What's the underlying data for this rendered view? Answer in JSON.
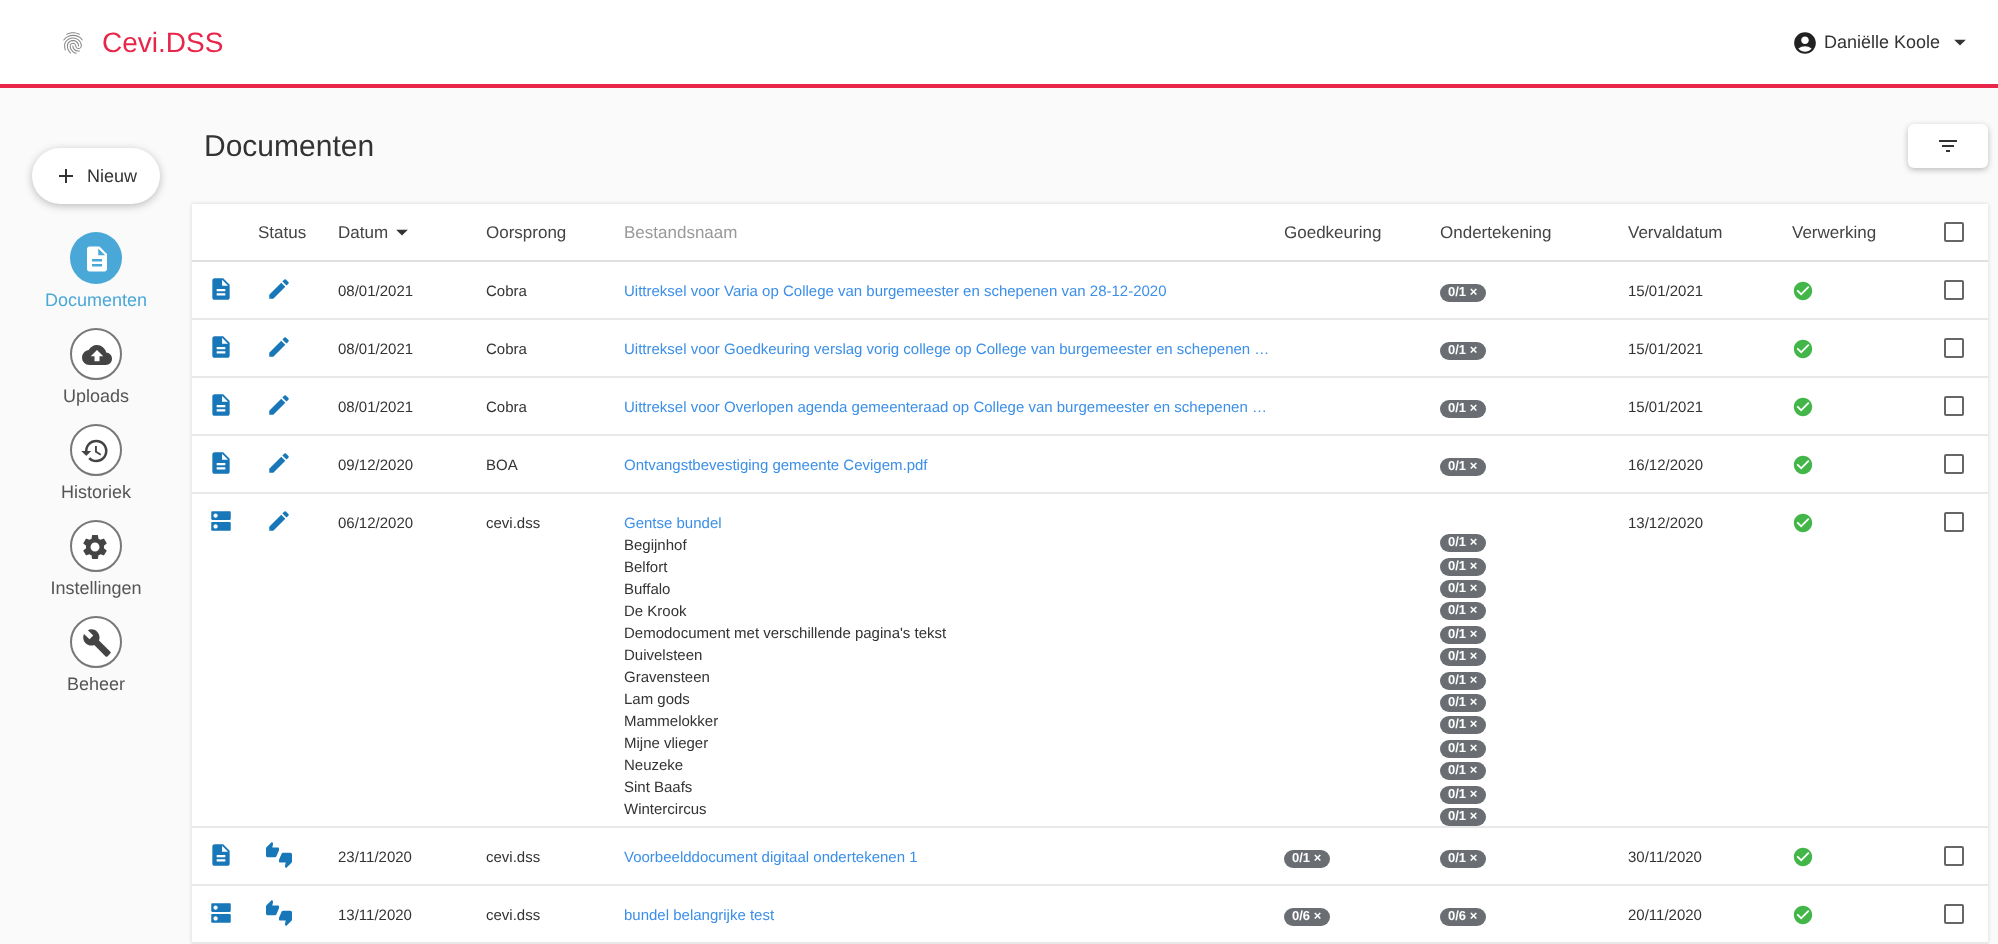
{
  "app": {
    "title": "Cevi.DSS"
  },
  "user": {
    "name": "Daniëlle Koole"
  },
  "new_button": {
    "label": "Nieuw"
  },
  "sidebar": {
    "items": [
      {
        "label": "Documenten",
        "kind": "documents",
        "selected": true
      },
      {
        "label": "Uploads",
        "kind": "uploads",
        "selected": false
      },
      {
        "label": "Historiek",
        "kind": "history",
        "selected": false
      },
      {
        "label": "Instellingen",
        "kind": "settings",
        "selected": false
      },
      {
        "label": "Beheer",
        "kind": "admin",
        "selected": false
      }
    ]
  },
  "page": {
    "title": "Documenten"
  },
  "table": {
    "columns": [
      "Status",
      "Datum",
      "Oorsprong",
      "Bestandsnaam",
      "Goedkeuring",
      "Ondertekening",
      "Vervaldatum",
      "Verwerking"
    ],
    "select_all": {
      "checked": false
    },
    "rows": [
      {
        "kind": "document",
        "status": {
          "kind": "edit"
        },
        "date": "08/01/2021",
        "origin": "Cobra",
        "name": "Uittreksel voor Varia op College van burgemeester en schepenen van 28-12-2020",
        "signing": "0/1 ×",
        "due": "15/01/2021",
        "processed": true,
        "checked": false
      },
      {
        "kind": "document",
        "status": {
          "kind": "edit"
        },
        "date": "08/01/2021",
        "origin": "Cobra",
        "name": "Uittreksel voor Goedkeuring verslag vorig college op College van burgemeester en schepenen …",
        "signing": "0/1 ×",
        "due": "15/01/2021",
        "processed": true,
        "checked": false
      },
      {
        "kind": "document",
        "status": {
          "kind": "edit"
        },
        "date": "08/01/2021",
        "origin": "Cobra",
        "name": "Uittreksel voor Overlopen agenda gemeenteraad op College van burgemeester en schepenen …",
        "signing": "0/1 ×",
        "due": "15/01/2021",
        "processed": true,
        "checked": false
      },
      {
        "kind": "document",
        "status": {
          "kind": "edit"
        },
        "date": "09/12/2020",
        "origin": "BOA",
        "name": "Ontvangstbevestiging gemeente Cevigem.pdf",
        "signing": "0/1 ×",
        "due": "16/12/2020",
        "processed": true,
        "checked": false
      },
      {
        "kind": "bundle",
        "status": {
          "kind": "edit"
        },
        "date": "06/12/2020",
        "origin": "cevi.dss",
        "name": "Gentse bundel",
        "due": "13/12/2020",
        "processed": true,
        "checked": false,
        "children": [
          {
            "name": "Begijnhof",
            "signing": "0/1 ×"
          },
          {
            "name": "Belfort",
            "signing": "0/1 ×"
          },
          {
            "name": "Buffalo",
            "signing": "0/1 ×"
          },
          {
            "name": "De Krook",
            "signing": "0/1 ×"
          },
          {
            "name": "Demodocument met verschillende pagina's tekst",
            "signing": "0/1 ×"
          },
          {
            "name": "Duivelsteen",
            "signing": "0/1 ×"
          },
          {
            "name": "Gravensteen",
            "signing": "0/1 ×"
          },
          {
            "name": "Lam gods",
            "signing": "0/1 ×"
          },
          {
            "name": "Mammelokker",
            "signing": "0/1 ×"
          },
          {
            "name": "Mijne vlieger",
            "signing": "0/1 ×"
          },
          {
            "name": "Neuzeke",
            "signing": "0/1 ×"
          },
          {
            "name": "Sint Baafs",
            "signing": "0/1 ×"
          },
          {
            "name": "Wintercircus",
            "signing": "0/1 ×"
          }
        ]
      },
      {
        "kind": "document",
        "status": {
          "kind": "approve"
        },
        "date": "23/11/2020",
        "origin": "cevi.dss",
        "name": "Voorbeelddocument digitaal ondertekenen 1",
        "approval": "0/1 ×",
        "signing": "0/1 ×",
        "due": "30/11/2020",
        "processed": true,
        "checked": false
      },
      {
        "kind": "bundle",
        "status": {
          "kind": "approve"
        },
        "date": "13/11/2020",
        "origin": "cevi.dss",
        "name": "bundel belangrijke test",
        "approval": "0/6 ×",
        "signing": "0/6 ×",
        "due": "20/11/2020",
        "processed": true,
        "checked": false
      }
    ]
  }
}
